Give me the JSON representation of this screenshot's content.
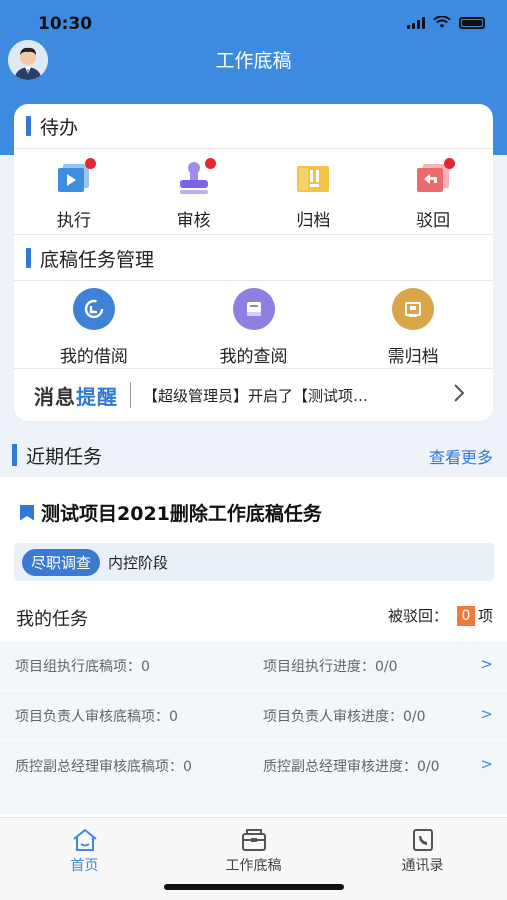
{
  "status": {
    "time": "10:30"
  },
  "header": {
    "title": "工作底稿"
  },
  "todo": {
    "title": "待办",
    "items": [
      {
        "label": "执行",
        "icon": "play-folder-icon",
        "badge": true
      },
      {
        "label": "审核",
        "icon": "stamp-icon",
        "badge": true
      },
      {
        "label": "归档",
        "icon": "archive-icon",
        "badge": false
      },
      {
        "label": "驳回",
        "icon": "return-folder-icon",
        "badge": true
      }
    ]
  },
  "manage": {
    "title": "底稿任务管理",
    "items": [
      {
        "label": "我的借阅",
        "icon": "refresh-icon",
        "color": "#3d82d8"
      },
      {
        "label": "我的查阅",
        "icon": "book-icon",
        "color": "#8f7fe0"
      },
      {
        "label": "需归档",
        "icon": "archive-box-icon",
        "color": "#d9a54a"
      }
    ]
  },
  "notice": {
    "logo_a": "消息",
    "logo_b": "提醒",
    "text": "【超级管理员】开启了【测试项…"
  },
  "recent": {
    "title": "近期任务",
    "more": "查看更多"
  },
  "task": {
    "title": "测试项目2021删除工作底稿任务",
    "tag": "尽职调查",
    "stage": "内控阶段",
    "my_tasks": "我的任务",
    "rejected_label": "被驳回：",
    "rejected_count": "0",
    "rejected_unit": "项",
    "rows": [
      {
        "left": "项目组执行底稿项：0",
        "right": "项目组执行进度：0/0"
      },
      {
        "left": "项目负责人审核底稿项：0",
        "right": "项目负责人审核进度：0/0"
      },
      {
        "left": "质控副总经理审核底稿项：0",
        "right": "质控副总经理审核进度：0/0"
      }
    ],
    "chevron": ">"
  },
  "tabs": [
    {
      "label": "首页",
      "icon": "home-icon",
      "active": true
    },
    {
      "label": "工作底稿",
      "icon": "folder-icon",
      "active": false
    },
    {
      "label": "通讯录",
      "icon": "phone-book-icon",
      "active": false
    }
  ],
  "colors": {
    "primary": "#3d8be0",
    "badge": "#e8262f",
    "accent": "#f07a3a"
  }
}
